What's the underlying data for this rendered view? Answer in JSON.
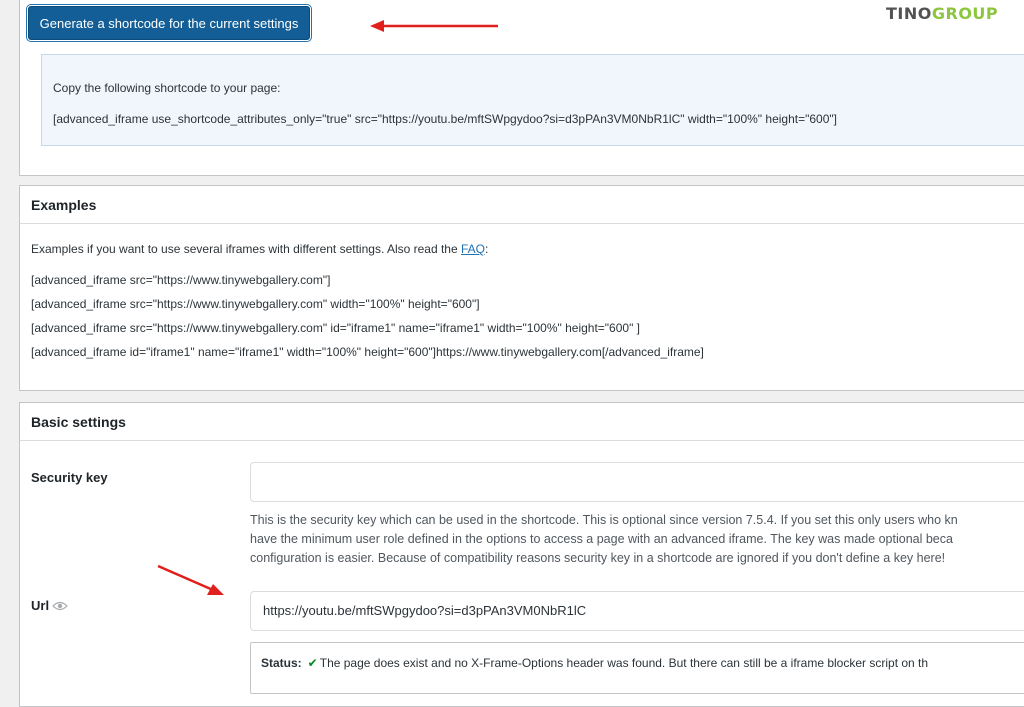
{
  "top": {
    "generate_button": "Generate a shortcode for the current settings",
    "logo": {
      "part1": "TINO",
      "part2": "GROUP"
    },
    "info_intro": "Copy the following shortcode to your page:",
    "shortcode": "[advanced_iframe use_shortcode_attributes_only=\"true\" src=\"https://youtu.be/mftSWpgydoo?si=d3pPAn3VM0NbR1lC\" width=\"100%\" height=\"600\"]"
  },
  "examples": {
    "title": "Examples",
    "intro": "Examples if you want to use several iframes with different settings. Also read the ",
    "faq_link": "FAQ",
    "intro_end": ":",
    "lines": [
      "[advanced_iframe src=\"https://www.tinywebgallery.com\"]",
      "[advanced_iframe src=\"https://www.tinywebgallery.com\" width=\"100%\" height=\"600\"]",
      "[advanced_iframe src=\"https://www.tinywebgallery.com\" id=\"iframe1\" name=\"iframe1\" width=\"100%\" height=\"600\" ]",
      "[advanced_iframe id=\"iframe1\" name=\"iframe1\" width=\"100%\" height=\"600\"]https://www.tinywebgallery.com[/advanced_iframe]"
    ]
  },
  "basic": {
    "title": "Basic settings",
    "security_key_label": "Security key",
    "security_key_value": "",
    "security_desc": [
      "This is the security key which can be used in the shortcode. This is optional since version 7.5.4. If you set this only users who kn",
      "have the minimum user role defined in the options to access a page with an advanced iframe. The key was made optional beca",
      "configuration is easier. Because of compatibility reasons security key in a shortcode are ignored if you don't define a key here!"
    ],
    "url_label": "Url",
    "url_value": "https://youtu.be/mftSWpgydoo?si=d3pPAn3VM0NbR1lC",
    "status_label": "Status:",
    "status_text": "The page does exist and no X-Frame-Options header was found. But there can still be a iframe blocker script on th"
  },
  "colors": {
    "primary_button": "#135e96",
    "annotation_arrow": "#e0201c",
    "status_ok": "#008a20",
    "logo_green": "#8cc63f"
  }
}
